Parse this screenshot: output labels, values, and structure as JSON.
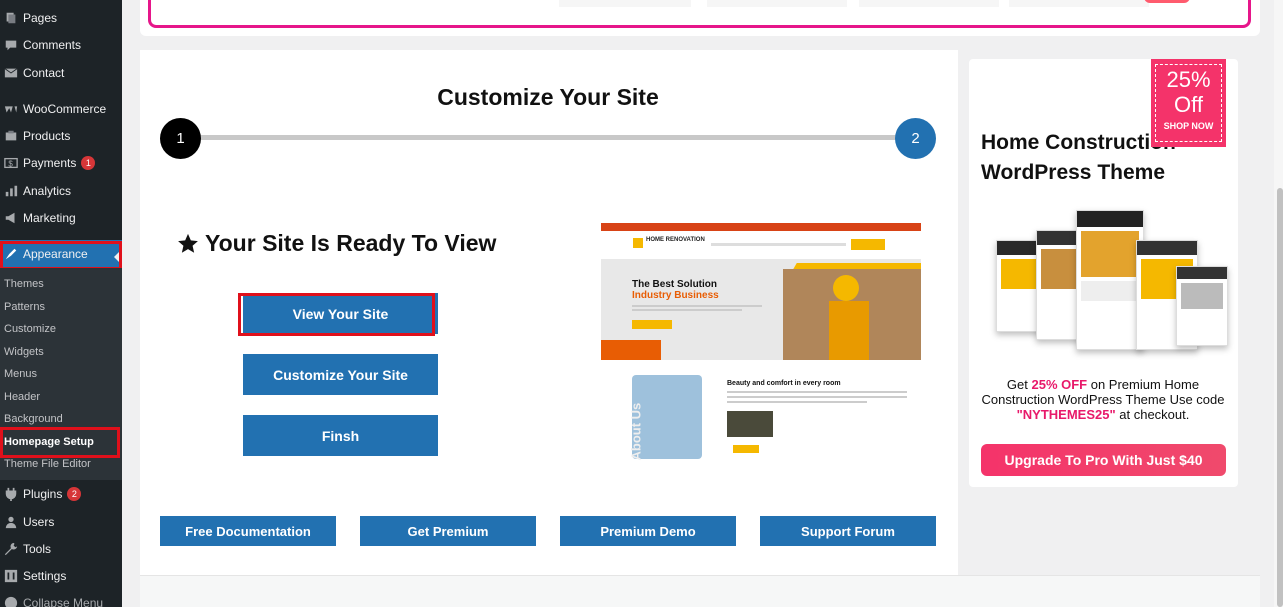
{
  "sidebar": {
    "items": [
      {
        "label": "Pages",
        "icon": "pages-icon"
      },
      {
        "label": "Comments",
        "icon": "comments-icon"
      },
      {
        "label": "Contact",
        "icon": "contact-icon"
      },
      {
        "label": "WooCommerce",
        "icon": "woocommerce-icon"
      },
      {
        "label": "Products",
        "icon": "products-icon"
      },
      {
        "label": "Payments",
        "icon": "payments-icon",
        "badge": "1"
      },
      {
        "label": "Analytics",
        "icon": "analytics-icon"
      },
      {
        "label": "Marketing",
        "icon": "marketing-icon"
      },
      {
        "label": "Appearance",
        "icon": "appearance-icon"
      },
      {
        "label": "Plugins",
        "icon": "plugins-icon",
        "badge": "2"
      },
      {
        "label": "Users",
        "icon": "users-icon"
      },
      {
        "label": "Tools",
        "icon": "tools-icon"
      },
      {
        "label": "Settings",
        "icon": "settings-icon"
      },
      {
        "label": "Collapse Menu",
        "icon": "collapse-icon"
      }
    ],
    "submenu": [
      "Themes",
      "Patterns",
      "Customize",
      "Widgets",
      "Menus",
      "Header",
      "Background",
      "Homepage Setup",
      "Theme File Editor"
    ],
    "accent": "#2271b1"
  },
  "main": {
    "heading": "Customize Your Site",
    "steps": [
      "1",
      "2"
    ],
    "ready_title": "Your Site Is Ready To View",
    "buttons": {
      "view": "View Your Site",
      "customize": "Customize Your Site",
      "finish": "Finsh"
    },
    "links": {
      "docs": "Free Documentation",
      "premium": "Get Premium",
      "demo": "Premium Demo",
      "forum": "Support Forum"
    },
    "preview": {
      "brand": "HOME RENOVATION",
      "hero_title_1": "The Best Solution",
      "hero_title_2": "Industry Business",
      "about_title": "Beauty and comfort in every room",
      "vertical_text": "About Us"
    }
  },
  "promo": {
    "title": "Home Construction WordPress Theme",
    "badge_pct": "25%",
    "badge_off": "Off",
    "badge_shop": "SHOP NOW",
    "text_prefix": "Get ",
    "text_discount": "25% OFF",
    "text_middle": " on Premium Home Construction WordPress Theme Use code ",
    "text_code": "\"NYTHEMES25\"",
    "text_suffix": " at checkout.",
    "button": "Upgrade To Pro With Just $40",
    "accent": "#f4336a"
  }
}
